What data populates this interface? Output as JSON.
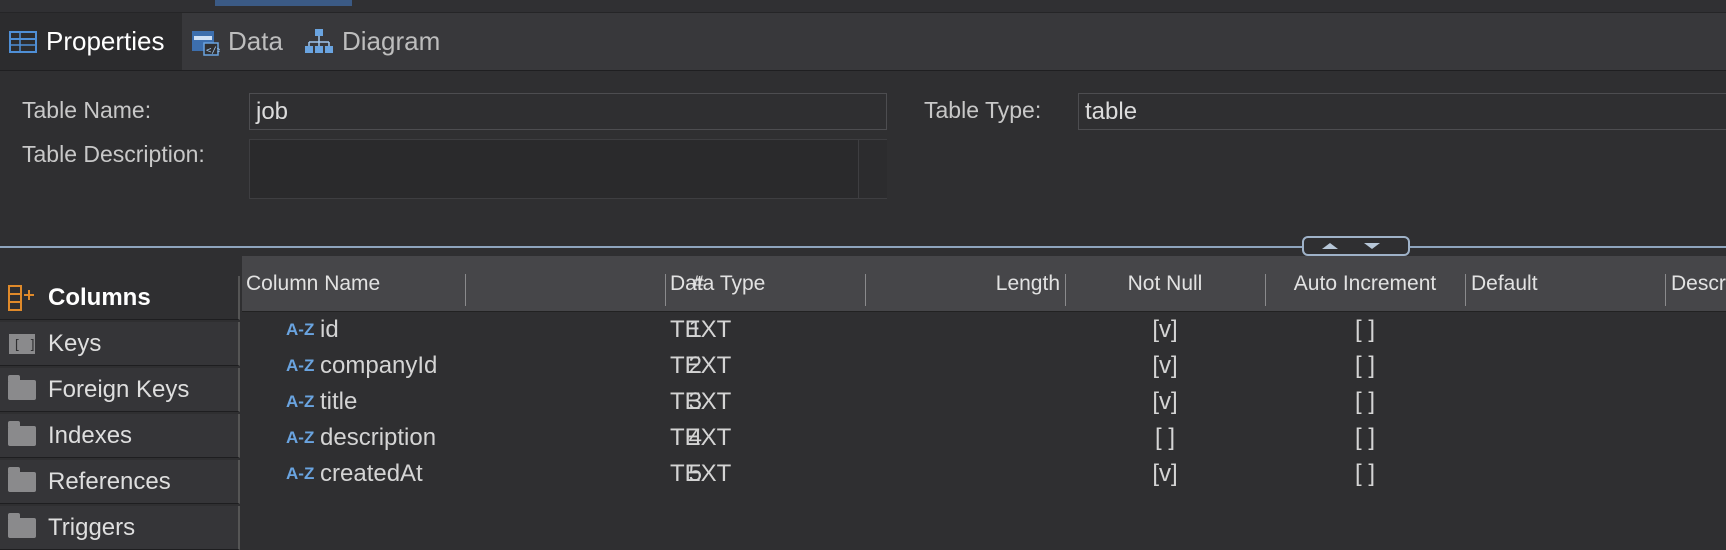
{
  "tabs": [
    {
      "label": "Properties",
      "icon": "table-icon",
      "active": true
    },
    {
      "label": "Data",
      "icon": "data-icon",
      "active": false
    },
    {
      "label": "Diagram",
      "icon": "diagram-icon",
      "active": false
    }
  ],
  "properties": {
    "table_name_label": "Table Name:",
    "table_name_value": "job",
    "table_type_label": "Table Type:",
    "table_type_value": "table",
    "table_description_label": "Table Description:",
    "table_description_value": ""
  },
  "sidebar": {
    "items": [
      {
        "label": "Columns",
        "icon": "columns-icon",
        "active": true
      },
      {
        "label": "Keys",
        "icon": "keys-icon",
        "active": false
      },
      {
        "label": "Foreign Keys",
        "icon": "folder-icon",
        "active": false
      },
      {
        "label": "Indexes",
        "icon": "folder-icon",
        "active": false
      },
      {
        "label": "References",
        "icon": "folder-icon",
        "active": false
      },
      {
        "label": "Triggers",
        "icon": "folder-icon",
        "active": false
      }
    ]
  },
  "columns_table": {
    "headers": [
      "Column Name",
      "#",
      "Data Type",
      "Length",
      "Not Null",
      "Auto Increment",
      "Default",
      "Descr"
    ],
    "type_icon_text": "A-Z",
    "rows": [
      {
        "name": "id",
        "num": "1",
        "type": "TEXT",
        "length": "",
        "not_null": "[v]",
        "auto_inc": "[ ]",
        "default": ""
      },
      {
        "name": "companyId",
        "num": "2",
        "type": "TEXT",
        "length": "",
        "not_null": "[v]",
        "auto_inc": "[ ]",
        "default": ""
      },
      {
        "name": "title",
        "num": "3",
        "type": "TEXT",
        "length": "",
        "not_null": "[v]",
        "auto_inc": "[ ]",
        "default": ""
      },
      {
        "name": "description",
        "num": "4",
        "type": "TEXT",
        "length": "",
        "not_null": "[ ]",
        "auto_inc": "[ ]",
        "default": ""
      },
      {
        "name": "createdAt",
        "num": "5",
        "type": "TEXT",
        "length": "",
        "not_null": "[v]",
        "auto_inc": "[ ]",
        "default": ""
      }
    ]
  },
  "colors": {
    "accent": "#3b5a85",
    "az_icon": "#6aa4e0",
    "columns_icon": "#e08a2a"
  }
}
